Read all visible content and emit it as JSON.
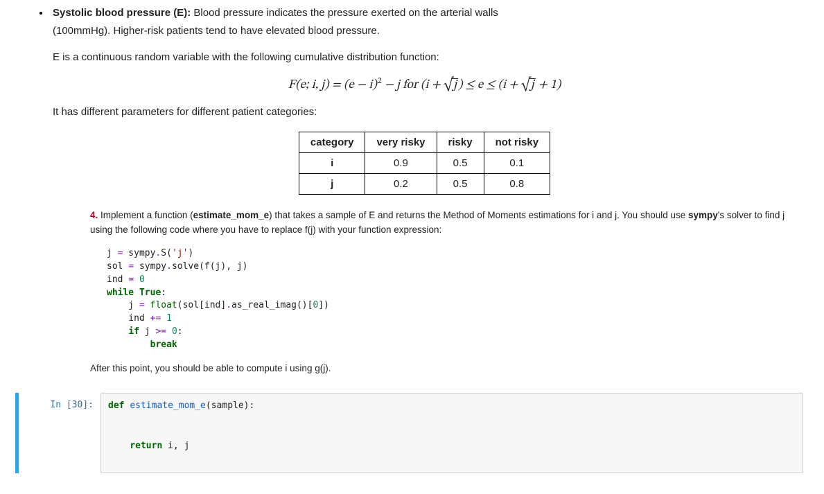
{
  "section": {
    "title_bold": "Systolic blood pressure (E):",
    "intro_line1_rest": " Blood pressure indicates the pressure exerted on the arterial walls",
    "intro_line2": "(100mmHg). Higher-risk patients tend to have elevated blood pressure.",
    "intro_line3": "E is a continuous random variable with the following cumulative distribution function:",
    "after_formula": "It has different parameters for different patient categories:"
  },
  "formula": {
    "lhs": "F(e; i, j)",
    "eq": " = ",
    "term1_open": "(e − i)",
    "sup": "2",
    "minus_j_for": " − j for ",
    "range_pre": "(i + ",
    "range_sqrt_arg": "j",
    "range_mid": ") ≤ e ≤ (i + ",
    "range_sqrt_arg2": "j",
    "range_end": " + 1)"
  },
  "table": {
    "headers": [
      "category",
      "very risky",
      "risky",
      "not risky"
    ],
    "rows": [
      {
        "label": "i",
        "values": [
          "0.9",
          "0.5",
          "0.1"
        ]
      },
      {
        "label": "j",
        "values": [
          "0.2",
          "0.5",
          "0.8"
        ]
      }
    ]
  },
  "task": {
    "number": "4.",
    "text_part1": " Implement a function (",
    "fn_name": "estimate_mom_e",
    "text_part2": ") that takes a sample of E and returns the Method of Moments estimations for i and j. You should use ",
    "sympy": "sympy",
    "text_part3": "'s solver to find j using the following code where you have to replace f(j) with your function expression:"
  },
  "snippet": {
    "l1_a": "j ",
    "l1_op1": "=",
    "l1_b": " sympy",
    "l1_op2": ".",
    "l1_c": "S(",
    "l1_str": "'j'",
    "l1_d": ")",
    "l2_a": "sol ",
    "l2_op1": "=",
    "l2_b": " sympy",
    "l2_op2": ".",
    "l2_c": "solve(f(j), j)",
    "l3_a": "ind ",
    "l3_op1": "=",
    "l3_b": " ",
    "l3_num": "0",
    "l4_kw1": "while",
    "l4_sp": " ",
    "l4_kw2": "True",
    "l4_colon": ":",
    "l5_a": "    j ",
    "l5_op1": "=",
    "l5_b": " ",
    "l5_float": "float",
    "l5_c": "(sol[ind]",
    "l5_op2": ".",
    "l5_d": "as_real_imag()[",
    "l5_num": "0",
    "l5_e": "])",
    "l6_a": "    ind ",
    "l6_op1": "+=",
    "l6_b": " ",
    "l6_num": "1",
    "l7_a": "    ",
    "l7_kw": "if",
    "l7_b": " j ",
    "l7_op": ">=",
    "l7_c": " ",
    "l7_num": "0",
    "l7_colon": ":",
    "l8_a": "        ",
    "l8_kw": "break"
  },
  "after_code": "After this point, you should be able to compute i using g(j).",
  "cell": {
    "prompt": "In [30]:",
    "code": {
      "l1_kw": "def",
      "l1_sp": " ",
      "l1_fn": "estimate_mom_e",
      "l1_params": "(sample):",
      "blank": "",
      "l2_indent": "    ",
      "l2_kw": "return",
      "l2_rest": " i, j"
    }
  }
}
